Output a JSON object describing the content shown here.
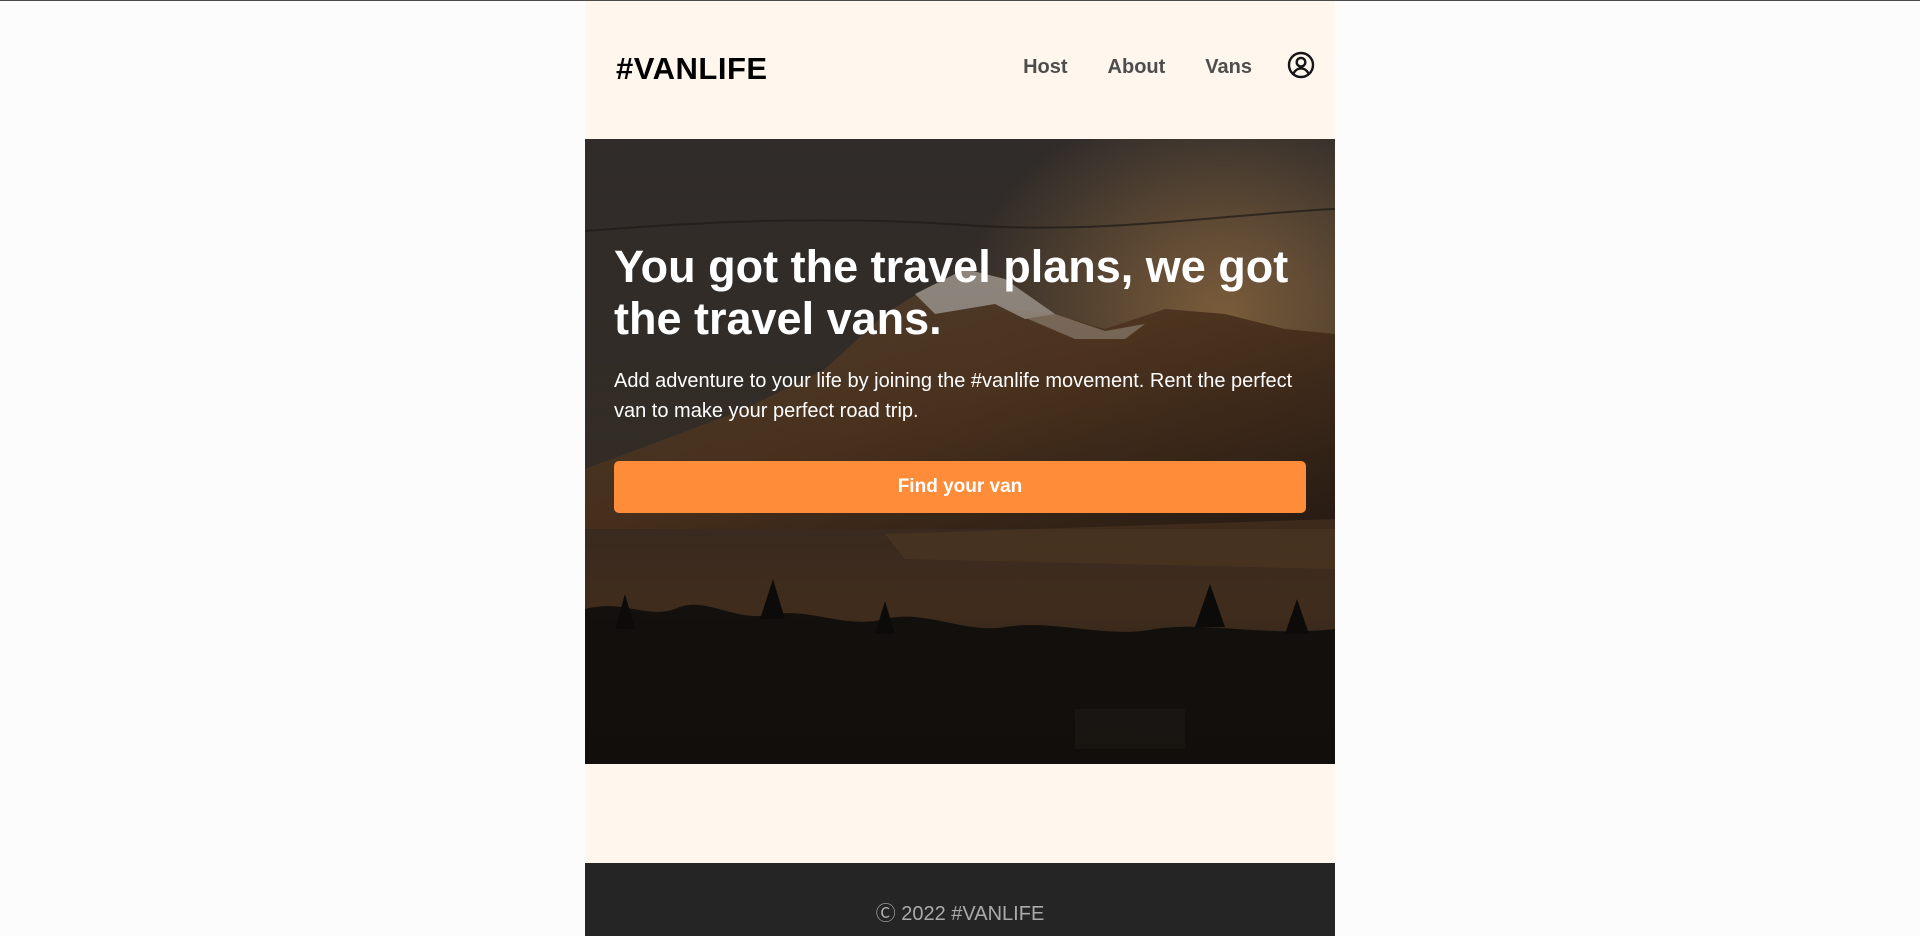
{
  "header": {
    "logo": "#VANLIFE",
    "nav": {
      "host": "Host",
      "about": "About",
      "vans": "Vans"
    },
    "user_icon": "user-circle-icon"
  },
  "hero": {
    "title": "You got the travel plans, we got the travel vans.",
    "text": "Add adventure to your life by joining the #vanlife movement. Rent the perfect van to make your perfect road trip.",
    "button_label": "Find your van",
    "background": "mountain-lake-sunset-image"
  },
  "footer": {
    "text": "Ⓒ 2022 #VANLIFE"
  },
  "colors": {
    "page_bg": "#fff6ee",
    "accent": "#ff8c38",
    "footer_bg": "#252525",
    "nav_text": "#4d4d4d"
  }
}
